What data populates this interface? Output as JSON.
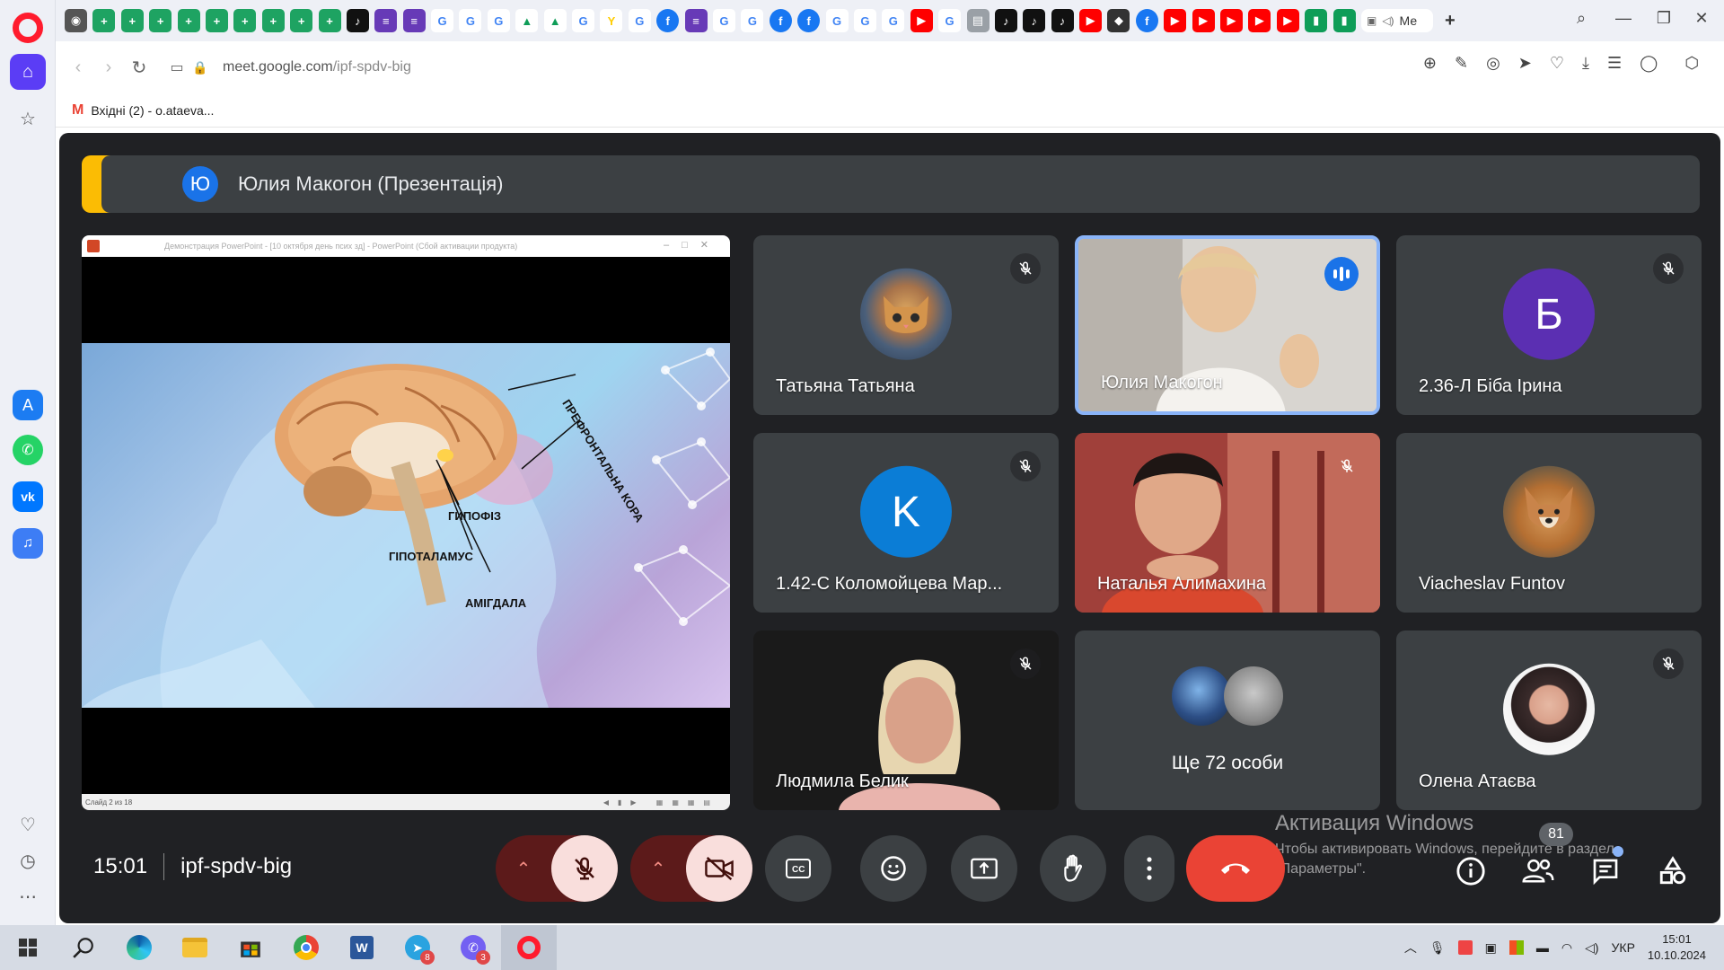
{
  "browser": {
    "url_host": "meet.google.com",
    "url_path": "/ipf-spdv-big",
    "bookmark": "Вхідні (2) - o.ataeva...",
    "active_tab_label": "Ме"
  },
  "meet": {
    "banner_initial": "Ю",
    "banner_text": "Юлия Макогон (Презентація)",
    "time": "15:01",
    "meeting_code": "ipf-spdv-big",
    "participants_count": "81"
  },
  "presentation": {
    "window_title": "Демонстрация PowerPoint - [10 октября день псих зд] - PowerPoint (Сбой активации продукта)",
    "status": "Слайд 2 из 18",
    "labels": {
      "prefrontal": "ПРЕФРОНТАЛЬНА КОРА",
      "pituitary": "ГИПОФІЗ",
      "hypothalamus": "ГІПОТАЛАМУС",
      "amygdala": "АМІГДАЛА"
    }
  },
  "tiles": [
    {
      "name": "Татьяна Татьяна",
      "muted": true
    },
    {
      "name": "Юлия Макогон",
      "speaking": true
    },
    {
      "name": "2.36-Л Біба Ірина",
      "initial": "Б",
      "muted": true
    },
    {
      "name": "1.42-С Коломойцева Мар...",
      "initial": "K",
      "muted": true
    },
    {
      "name": "Наталья Алимахина",
      "muted": true
    },
    {
      "name": "Viacheslav Funtov"
    },
    {
      "name": "Людмила Белик",
      "muted": true
    },
    {
      "name": "Ще 72 особи"
    },
    {
      "name": "Олена Атаєва",
      "muted": true
    }
  ],
  "windows_activation": {
    "title": "Активация Windows",
    "line1": "Чтобы активировать Windows, перейдите в раздел",
    "line2": "\"Параметры\"."
  },
  "taskbar": {
    "telegram_badge": "8",
    "viber_badge": "3",
    "language": "УКР",
    "time": "15:01",
    "date": "10.10.2024"
  },
  "colors": {
    "meet_bg": "#202124",
    "tile_bg": "#3c4043",
    "accent_blue": "#1a73e8",
    "end_call_red": "#ea4335",
    "present_yellow": "#fbbc04"
  }
}
